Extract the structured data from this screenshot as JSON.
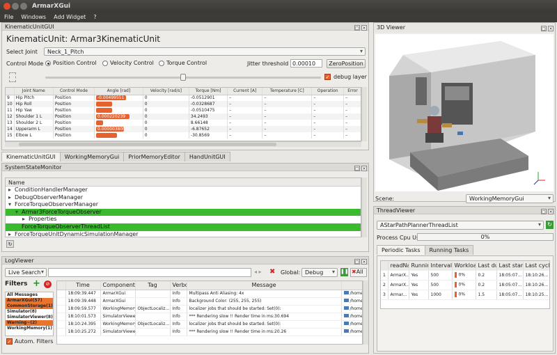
{
  "window": {
    "title": "ArmarXGui"
  },
  "menu": [
    "File",
    "Windows",
    "Add Widget",
    "?"
  ],
  "kinematic": {
    "dock_title": "KinematicUnitGUI",
    "heading": "KinematicUnit: Armar3KinematicUnit",
    "select_joint_label": "Select Joint",
    "selected_joint": "Neck_1_Pitch",
    "control_mode_label": "Control Mode",
    "modes": [
      "Position Control",
      "Velocity Control",
      "Torque Control"
    ],
    "jitter_label": "Jitter threshold",
    "jitter_value": "0.00010",
    "zero_position": "ZeroPosition",
    "debug_layer": "debug layer",
    "columns": [
      "Joint Name",
      "Control Mode",
      "Angle [rad]",
      "Velocity [rad/s]",
      "Torque [Nm]",
      "Current [A]",
      "Temperature [C]",
      "Operation",
      "Error"
    ],
    "rows": [
      {
        "n": "9",
        "joint": "Hip Pitch",
        "mode": "Position",
        "angle": "-0.00499551",
        "bar": 0.85,
        "vel": "0",
        "torque": "-0.0512901",
        "cur": "–",
        "temp": "–",
        "op": "–",
        "err": "–"
      },
      {
        "n": "10",
        "joint": "Hip Roll",
        "mode": "Position",
        "angle": "",
        "bar": 0.45,
        "vel": "0",
        "torque": "-0.0328687",
        "cur": "–",
        "temp": "–",
        "op": "–",
        "err": "–"
      },
      {
        "n": "11",
        "joint": "Hip Yaw",
        "mode": "Position",
        "angle": "",
        "bar": 0.45,
        "vel": "0",
        "torque": "-0.0510475",
        "cur": "–",
        "temp": "–",
        "op": "–",
        "err": "–"
      },
      {
        "n": "12",
        "joint": "Shoulder 1 L",
        "mode": "Position",
        "angle": "0.000220239",
        "bar": 0.95,
        "vel": "0",
        "torque": "34.2493",
        "cur": "–",
        "temp": "–",
        "op": "–",
        "err": "–"
      },
      {
        "n": "13",
        "joint": "Shoulder 2 L",
        "mode": "Position",
        "angle": "",
        "bar": 0.2,
        "vel": "0",
        "torque": "8.66148",
        "cur": "–",
        "temp": "–",
        "op": "–",
        "err": "–"
      },
      {
        "n": "14",
        "joint": "Upperarm L",
        "mode": "Position",
        "angle": "0.00000380032",
        "bar": 0.8,
        "vel": "0",
        "torque": "-6.87652",
        "cur": "–",
        "temp": "–",
        "op": "–",
        "err": "–"
      },
      {
        "n": "15",
        "joint": "Elbow L",
        "mode": "Position",
        "angle": "",
        "bar": 0.6,
        "vel": "0",
        "torque": "-30.8569",
        "cur": "–",
        "temp": "–",
        "op": "–",
        "err": "–"
      }
    ],
    "slider_fraction": 0.5
  },
  "tabs": [
    "KinematicUnitGUI",
    "WorkingMemoryGui",
    "PriorMemoryEditor",
    "HandUnitGUI"
  ],
  "ssm": {
    "dock_title": "SystemStateMonitor",
    "header": "Name",
    "items": [
      {
        "text": "ConditionHandlerManager",
        "indent": 0,
        "arrow": "▸",
        "sel": false
      },
      {
        "text": "DebugObserverManager",
        "indent": 0,
        "arrow": "▸",
        "sel": false
      },
      {
        "text": "ForceTorqueObserverManager",
        "indent": 0,
        "arrow": "▾",
        "sel": false
      },
      {
        "text": "Armar3ForceTorqueObserver",
        "indent": 1,
        "arrow": "▾",
        "sel": true
      },
      {
        "text": "Properties",
        "indent": 2,
        "arrow": "▸",
        "sel": false
      },
      {
        "text": "ForceTorqueObserverThreadList",
        "indent": 1,
        "arrow": "",
        "sel": true
      },
      {
        "text": "ForceTorqueUnitDynamicSimulationManager",
        "indent": 0,
        "arrow": "▸",
        "sel": false
      }
    ]
  },
  "log": {
    "dock_title": "LogViewer",
    "search_mode": "Live Search",
    "global_label": "Global:",
    "global_level": "Debug",
    "all_label": "All",
    "filters_label": "Filters",
    "autom_filters": "Autom. Filters",
    "filters": [
      {
        "text": "All Messages",
        "color": "#ffffff"
      },
      {
        "text": "ArmarXGui(57)",
        "color": "#e8742e"
      },
      {
        "text": "CommonStorage(1)",
        "color": "#e8742e"
      },
      {
        "text": "Simulator(8)",
        "color": "#ffffff"
      },
      {
        "text": "SimulatorViewer(8)",
        "color": "#ffffff"
      },
      {
        "text": "Warning~(2)",
        "color": "#e8742e"
      },
      {
        "text": "WorkingMemory(1)",
        "color": "#ffffff"
      }
    ],
    "columns": [
      "",
      "Time",
      "Component",
      "Tag",
      "Verbosity",
      "Message",
      ""
    ],
    "rows": [
      {
        "n": "",
        "time": "18:09:39.447",
        "comp": "ArmarXGui",
        "tag": "",
        "verb": "Info",
        "msg": "Multipass Anti Aliasing: 4x",
        "file": "/home/"
      },
      {
        "n": "",
        "time": "18:09:39.448",
        "comp": "ArmarXGui",
        "tag": "",
        "verb": "Info",
        "msg": "Background Color: (255, 255, 255)",
        "file": "/home/"
      },
      {
        "n": "",
        "time": "18:09:59.577",
        "comp": "WorkingMemory",
        "tag": "ObjectLocaliz...",
        "verb": "Info",
        "msg": "localizer jobs that should be started: Set(0):",
        "file": "/home/"
      },
      {
        "n": "",
        "time": "18:10:01.573",
        "comp": "SimulatorViewer",
        "tag": "",
        "verb": "Info",
        "msg": "*** Rendering slow !! Render time in ms:30.694",
        "file": "/home/"
      },
      {
        "n": "",
        "time": "18:10:24.395",
        "comp": "WorkingMemory",
        "tag": "ObjectLocaliz...",
        "verb": "Info",
        "msg": "localizer jobs that should be started: Set(0):",
        "file": "/home/"
      },
      {
        "n": "",
        "time": "18:10:25.272",
        "comp": "SimulatorViewer",
        "tag": "",
        "verb": "Info",
        "msg": "*** Rendering slow !! Render time in ms:20.26",
        "file": "/home/"
      }
    ]
  },
  "viewer3d": {
    "dock_title": "3D Viewer",
    "scene_label": "Scene:",
    "scene_value": "WorkingMemoryGui"
  },
  "thread": {
    "dock_title": "ThreadViewer",
    "selected": "AStarPathPlannerThreadList",
    "cpu_label": "Process Cpu Usage",
    "cpu_value": "0%",
    "tabs": [
      "Periodic Tasks",
      "Running Tasks"
    ],
    "columns": [
      "",
      "readNan",
      "Running",
      "Interval (ms)",
      "Workload",
      "Last duration",
      "Last start time",
      "Last cycle start"
    ],
    "rows": [
      {
        "n": "1",
        "name": "ArmarX...",
        "run": "Yes",
        "interval": "500",
        "load": "0%",
        "dur": "0.2",
        "start": "18:05:07...",
        "cycle": "18:10:26..."
      },
      {
        "n": "2",
        "name": "ArmarX...",
        "run": "Yes",
        "interval": "500",
        "load": "0%",
        "dur": "0.2",
        "start": "18:05:07...",
        "cycle": "18:10:26..."
      },
      {
        "n": "3",
        "name": "Armar...",
        "run": "Yes",
        "interval": "1000",
        "load": "0%",
        "dur": "1.5",
        "start": "18:05:07...",
        "cycle": "18:10:25..."
      }
    ]
  },
  "colors": {
    "accent": "#e5622e",
    "green": "#3cba2f",
    "titlebar": "#3c3b37"
  }
}
